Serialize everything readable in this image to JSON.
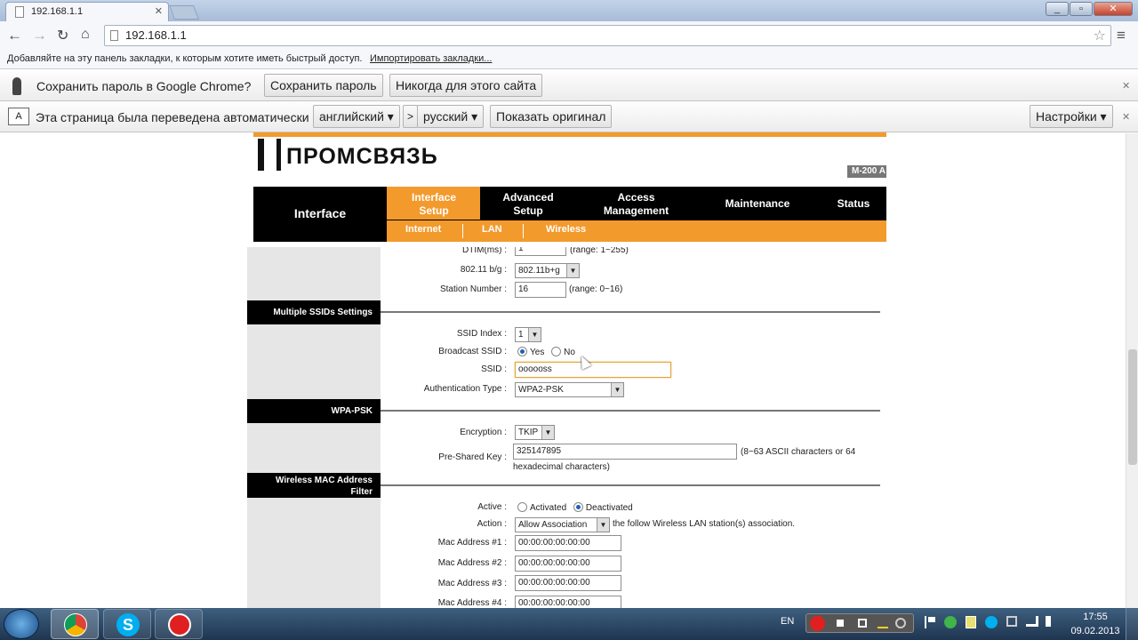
{
  "browser": {
    "tab_title": "192.168.1.1",
    "url": "192.168.1.1",
    "bookmarks_hint": "Добавляйте на эту панель закладки, к которым хотите иметь быстрый доступ.",
    "import_link": "Импортировать закладки...",
    "password_prompt": "Сохранить пароль в Google Chrome?",
    "save_password": "Сохранить пароль",
    "never_for_site": "Никогда для этого сайта",
    "translate_msg": "Эта страница была переведена автоматически",
    "lang_from": "английский",
    "arrow": ">",
    "lang_to": "русский",
    "show_original": "Показать оригинал",
    "settings": "Настройки",
    "min": "_",
    "max": "▫",
    "close": "✕"
  },
  "router": {
    "logo": "ПРОМСВЯЗЬ",
    "model": "M-200 A",
    "nav_title": "Interface",
    "nav": [
      "Interface Setup",
      "Advanced Setup",
      "Access Management",
      "Maintenance",
      "Status"
    ],
    "sub": [
      "Internet",
      "LAN",
      "Wireless"
    ]
  },
  "form": {
    "dtim_label": "DTIM(ms)",
    "dtim_value": "1",
    "dtim_note": "(range: 1~255)",
    "mode_label": "802.11 b/g",
    "mode_value": "802.11b+g",
    "station_label": "Station Number",
    "station_value": "16",
    "station_note": "(range: 0~16)",
    "ssids_section": "Multiple SSIDs Settings",
    "ssid_index_label": "SSID Index",
    "ssid_index_value": "1",
    "broadcast_label": "Broadcast SSID",
    "yes": "Yes",
    "no": "No",
    "ssid_label": "SSID",
    "ssid_value": "oooooss",
    "auth_label": "Authentication Type",
    "auth_value": "WPA2-PSK",
    "wpa_section": "WPA-PSK",
    "enc_label": "Encryption",
    "enc_value": "TKIP",
    "psk_label": "Pre-Shared Key",
    "psk_value": "325147895",
    "psk_note1": "(8~63 ASCII characters or 64",
    "psk_note2": "hexadecimal characters)",
    "mac_section": "Wireless MAC Address Filter",
    "active_label": "Active",
    "activated": "Activated",
    "deactivated": "Deactivated",
    "action_label": "Action",
    "action_value": "Allow Association",
    "action_note": "the follow Wireless LAN station(s) association.",
    "mac": [
      {
        "label": "Mac Address #1",
        "value": "00:00:00:00:00:00"
      },
      {
        "label": "Mac Address #2",
        "value": "00:00:00:00:00:00"
      },
      {
        "label": "Mac Address #3",
        "value": "00:00:00:00:00:00"
      },
      {
        "label": "Mac Address #4",
        "value": "00:00:00:00:00:00"
      }
    ],
    "colon": ":"
  },
  "taskbar": {
    "lang": "EN",
    "time": "17:55",
    "date": "09.02.2013"
  },
  "colors": {
    "accent": "#f39a2c",
    "nav_bg": "#000000",
    "sidebar": "#e6e6e6"
  }
}
